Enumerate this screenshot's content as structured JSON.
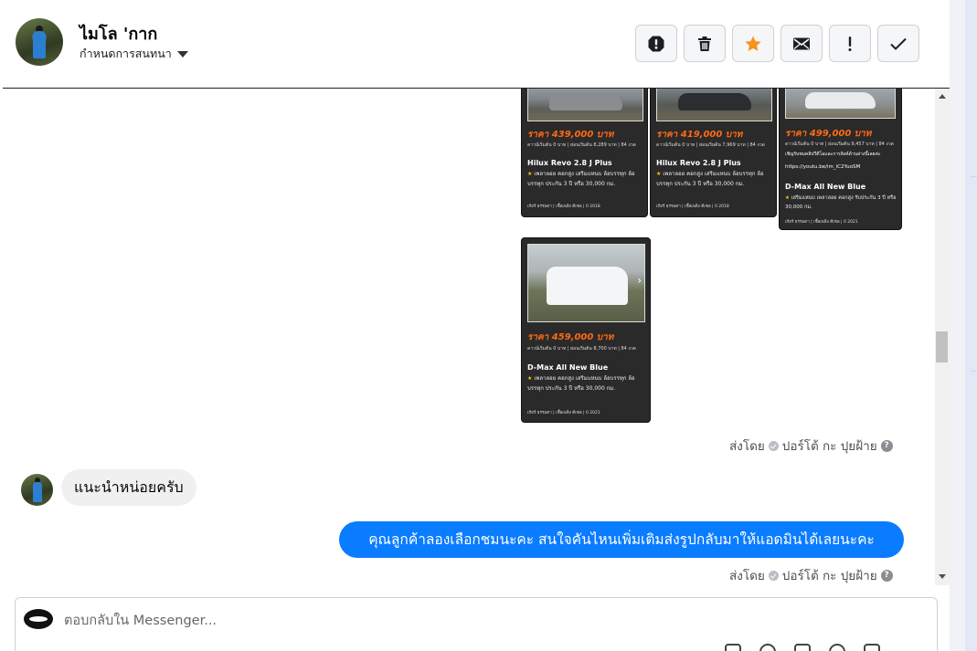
{
  "header": {
    "contact_name": "ไมโล 'กาก",
    "assign_label": "กำหนดการสนทนา",
    "actions": [
      {
        "icon": "alert-circle-icon",
        "name": "spam-button"
      },
      {
        "icon": "trash-icon",
        "name": "delete-button"
      },
      {
        "icon": "star-icon",
        "name": "star-button"
      },
      {
        "icon": "envelope-icon",
        "name": "mark-unread-button"
      },
      {
        "icon": "exclamation-icon",
        "name": "follow-up-button"
      },
      {
        "icon": "checkmark-icon",
        "name": "mark-done-button"
      }
    ]
  },
  "cards": [
    {
      "price": "ราคา 439,000 บาท",
      "terms": "ดาวน์เริ่มต้น 0 บาท | ผ่อนเริ่มต้น 8,289 บาท | 84 งวด",
      "model": "Hilux Revo 2.8 J Plus",
      "desc": "เพลาลอย คอกสูง เสริมแหนบ ล้อบรรทุก ล้อบรรทุก ประกัน 3 ปี หรือ 30,000 กม.",
      "foot": "เกียร์ ธรรมดา | เชื้อเพลิง ดีเซล | 0 2018"
    },
    {
      "price": "ราคา 419,000 บาท",
      "terms": "ดาวน์เริ่มต้น 0 บาท | ผ่อนเริ่มต้น 7,969 บาท | 84 งวด",
      "model": "Hilux Revo 2.8 J Plus",
      "desc": "เพลาลอย คอกสูง เสริมแหนบ ล้อบรรทุก ล้อบรรทุก ประกัน 3 ปี หรือ 30,000 กม.",
      "foot": "เกียร์ ธรรมดา | เชื้อเพลิง ดีเซล | 0 2018"
    },
    {
      "price": "ราคา 499,000 บาท",
      "terms": "ดาวน์เริ่มต้น 0 บาท | ผ่อนเริ่มต้น 9,457 บาท | 84 งวด",
      "extra": "เชิญรับชมคลิปวีดีโอและการลิงค์ด้านล่างนี้เลยค่ะ",
      "link": "https://youtu.be/im_iC2YuoSM",
      "model": "D-Max All New Blue",
      "desc": "เสริมแหนบ เพลาลอย คอกสูง รับประกัน 3 ปี หรือ 30,000 กม.",
      "foot": "เกียร์ ธรรมดา | เชื้อเพลิง ดีเซล | 0 2021"
    },
    {
      "price": "ราคา 459,000 บาท",
      "terms": "ดาวน์เริ่มต้น 0 บาท | ผ่อนเริ่มต้น 8,700 บาท | 84 งวด",
      "model": "D-Max All New Blue",
      "desc": "เพลาลอย คอกสูง เสริมแหนบ ล้อบรรทุก ล้อบรรทุก ประกัน 3 ปี หรือ 30,000 กม.",
      "foot": "เกียร์ ธรรมดา | เชื้อเพลิง ดีเซล | 0 2021"
    }
  ],
  "messages": {
    "sent_by_prefix": "ส่งโดย",
    "sent_by_name": "ปอร์โต้ กะ ปุยฝ้าย",
    "incoming_text": "แนะนำหน่อยครับ",
    "outgoing_text": "คุณลูกค้าลองเลือกชมนะคะ สนใจคันไหนเพิ่มเติมส่งรูปกลับมาให้แอดมินได้เลยนะคะ"
  },
  "composer": {
    "placeholder": "ตอบกลับใน Messenger..."
  },
  "colors": {
    "accent": "#0a7cff",
    "price": "#ff6a13",
    "card_bg": "#2a2a2a",
    "star_active": "#f7931e"
  }
}
